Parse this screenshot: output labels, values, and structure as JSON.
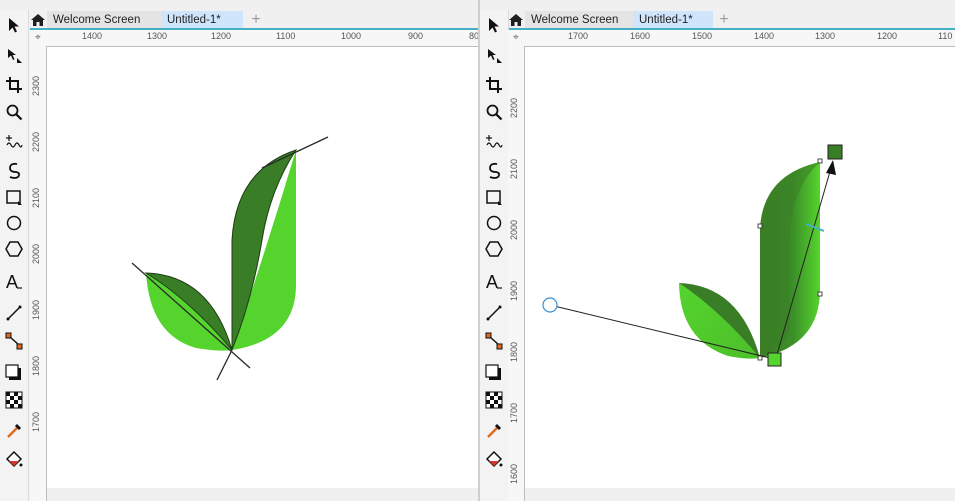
{
  "left_window": {
    "tabs": [
      {
        "label": "Welcome Screen",
        "icon": "home-icon"
      },
      {
        "label": "Untitled-1*",
        "active": true
      }
    ],
    "new_tab_icon": "plus-icon",
    "hruler_labels": [
      "1400",
      "1300",
      "1200",
      "1100",
      "1000",
      "900",
      "80"
    ],
    "vruler_labels": [
      "2300",
      "2200",
      "2100",
      "2000",
      "1900",
      "1800",
      "1700"
    ]
  },
  "right_window": {
    "tabs": [
      {
        "label": "Welcome Screen",
        "icon": "home-icon"
      },
      {
        "label": "Untitled-1*",
        "active": true
      }
    ],
    "new_tab_icon": "plus-icon",
    "hruler_labels": [
      "1700",
      "1600",
      "1500",
      "1400",
      "1300",
      "1200",
      "110"
    ],
    "vruler_labels": [
      "2200",
      "2100",
      "2000",
      "1900",
      "1800",
      "1700",
      "1600"
    ]
  },
  "tools": [
    "pick-tool-icon",
    "shape-tool-icon",
    "crop-tool-icon",
    "zoom-tool-icon",
    "freehand-tool-icon",
    "artistic-media-icon",
    "rectangle-tool-icon",
    "ellipse-tool-icon",
    "polygon-tool-icon",
    "text-tool-icon",
    "parallel-dimension-icon",
    "connector-tool-icon",
    "drop-shadow-icon",
    "transparency-tool-icon",
    "eyedropper-tool-icon",
    "interactive-fill-icon"
  ],
  "colors": {
    "dark_green": "#3a7d27",
    "light_green": "#55d42e",
    "tab_active": "#cfe5fb",
    "ruler_accent": "#43b0c3",
    "gradient_start_node": "#55d42e",
    "gradient_end_node": "#3a7d27",
    "midpoint_handle": "#43b0c3"
  }
}
